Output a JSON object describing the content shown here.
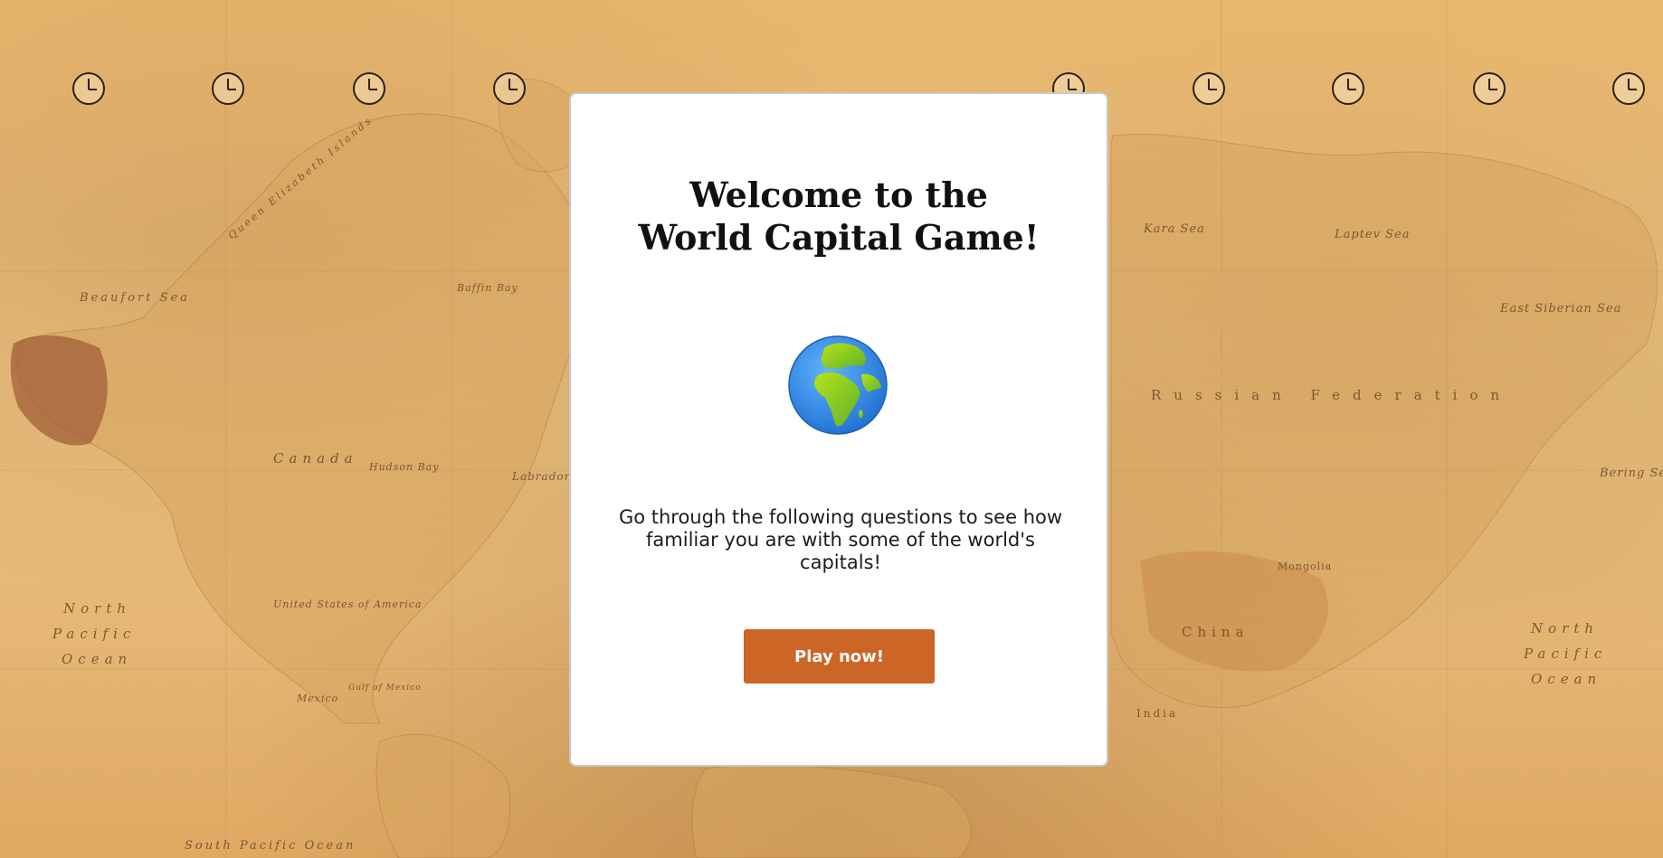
{
  "game": {
    "title_line1": "Welcome to the",
    "title_line2": "World Capital Game!",
    "globe_icon": "globe-europe-africa-emoji",
    "intro_text": "Go through the following questions to see how familiar you are with some of the world's capitals!",
    "play_button_label": "Play now!"
  },
  "map": {
    "labels": {
      "beaufort_sea": "Beaufort Sea",
      "canada": "Canada",
      "hudson_bay": "Hudson Bay",
      "labrador_sea": "Labrador Se",
      "baffin_bay": "Baffin Bay",
      "usa": "United States of America",
      "mexico": "Mexico",
      "gulf_of_mexico": "Gulf of Mexico",
      "north_pacific_west_1": "North",
      "north_pacific_west_2": "Pacific",
      "north_pacific_west_3": "Ocean",
      "south_pacific": "South Pacific Ocean",
      "kara_sea": "Kara Sea",
      "laptev_sea": "Laptev Sea",
      "east_siberian_sea": "East Siberian Sea",
      "russian_federation": "Russian Federation",
      "mongolia": "Mongolia",
      "china": "China",
      "india": "India",
      "bering_sea": "Bering Sea",
      "north_pacific_east_1": "North",
      "north_pacific_east_2": "Pacific",
      "north_pacific_east_3": "Ocean",
      "queen_elizabeth_islands": "Queen Elizabeth Islands"
    }
  },
  "colors": {
    "button": "#cc6526",
    "modal_bg": "#ffffff",
    "map_base": "#ecc583"
  }
}
